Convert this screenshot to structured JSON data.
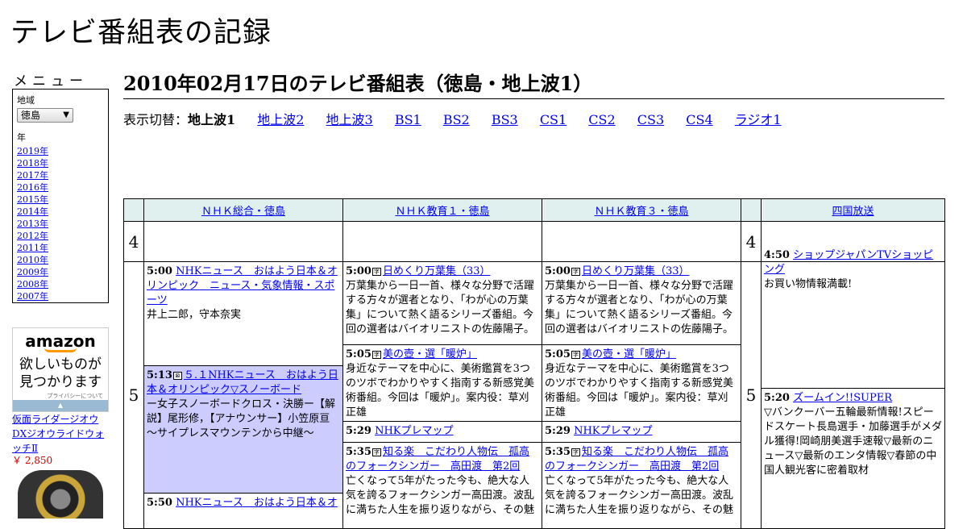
{
  "site": {
    "title": "テレビ番組表の記録"
  },
  "menu": {
    "title": "メニュー",
    "region_label": "地域",
    "region_value": "徳島",
    "year_label": "年",
    "years": [
      "2019年",
      "2018年",
      "2017年",
      "2016年",
      "2015年",
      "2014年",
      "2013年",
      "2012年",
      "2011年",
      "2010年",
      "2009年",
      "2008年",
      "2007年"
    ]
  },
  "ad": {
    "brand": "amazon",
    "text_line1": "欲しいものが",
    "text_line2": "見つかります",
    "privacy": "プライバシーについて",
    "product": "仮面ライダージオウ DXジオウライドウォッチⅡ",
    "price": "￥ 2,850"
  },
  "page": {
    "title": "2010年02月17日のテレビ番組表（徳島・地上波1）",
    "switch_label": "表示切替：",
    "current": "地上波1",
    "links": [
      "地上波2",
      "地上波3",
      "BS1",
      "BS2",
      "BS3",
      "CS1",
      "CS2",
      "CS3",
      "CS4",
      "ラジオ1"
    ]
  },
  "schedule": {
    "channels": [
      "ＮＨＫ総合・徳島",
      "ＮＨＫ教育１・徳島",
      "ＮＨＫ教育３・徳島",
      "四国放送"
    ],
    "hours": [
      "4",
      "5"
    ],
    "programs": {
      "nhk_sogo": [
        {
          "time": "5:00",
          "title": "NHKニュース　おはよう日本＆オリンピック　ニュース・気象情報・スポーツ",
          "desc": "井上二郎，守本奈実"
        },
        {
          "time": "5:13",
          "title": "５.１NHKニュース　おはよう日本＆オリンピック▽スノーボード",
          "desc": "ー女子スノーボードクロス・決勝ー【解説】尾形修，【アナウンサー】小笠原亘　～サイプレスマウンテンから中継～"
        },
        {
          "time": "5:50",
          "title": "NHKニュース　おはよう日本＆オ",
          "desc": ""
        }
      ],
      "nhk_e1": [
        {
          "time": "5:00",
          "title": "日めくり万葉集（33）",
          "desc": "万葉集から一日一首、様々な分野で活躍する方々が選者となり、「わが心の万葉集」について熱く語るシリーズ番組。今回の選者はバイオリニストの佐藤陽子。"
        },
        {
          "time": "5:05",
          "title": "美の壺・選「暖炉」",
          "desc": "身近なテーマを中心に、美術鑑賞を3つのツボでわかりやすく指南する新感覚美術番組。今回は「暖炉」。案内役：草刈正雄"
        },
        {
          "time": "5:29",
          "title": "NHKプレマップ",
          "desc": ""
        },
        {
          "time": "5:35",
          "title": "知る楽　こだわり人物伝　孤高のフォークシンガー　高田渡　第2回",
          "desc": "亡くなって5年がたった今も、絶大な人気を誇るフォークシンガー高田渡。波乱に満ちた人生を振り返りながら、その魅"
        }
      ],
      "nhk_e3": [
        {
          "time": "5:00",
          "title": "日めくり万葉集（33）",
          "desc": "万葉集から一日一首、様々な分野で活躍する方々が選者となり、「わが心の万葉集」について熱く語るシリーズ番組。今回の選者はバイオリニストの佐藤陽子。"
        },
        {
          "time": "5:05",
          "title": "美の壺・選「暖炉」",
          "desc": "身近なテーマを中心に、美術鑑賞を3つのツボでわかりやすく指南する新感覚美術番組。今回は「暖炉」。案内役：草刈正雄"
        },
        {
          "time": "5:29",
          "title": "NHKプレマップ",
          "desc": ""
        },
        {
          "time": "5:35",
          "title": "知る楽　こだわり人物伝　孤高のフォークシンガー　高田渡　第2回",
          "desc": "亡くなって5年がたった今も、絶大な人気を誇るフォークシンガー高田渡。波乱に満ちた人生を振り返りながら、その魅"
        }
      ],
      "shikoku": [
        {
          "time": "4:50",
          "title": "ショップジャパンTVショッピング",
          "desc": "お買い物情報満載!"
        },
        {
          "time": "5:20",
          "title": "ズームイン!!SUPER",
          "desc": "▽バンクーバー五輪最新情報!スピードスケート長島選手・加藤選手がメダル獲得!岡崎朋美選手速報▽最新のニュース▽最新のエンタ情報▽春節の中国人観光客に密着取材"
        }
      ]
    }
  }
}
